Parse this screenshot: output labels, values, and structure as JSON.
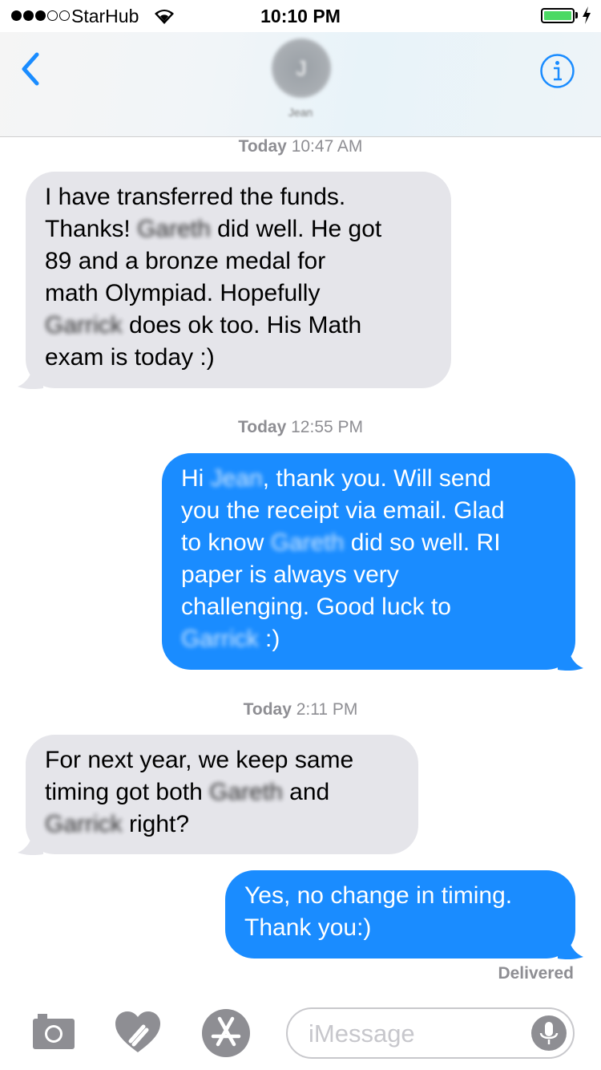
{
  "status_bar": {
    "carrier": "StarHub",
    "time": "10:10 PM",
    "signal_dots_filled": 3,
    "signal_dots_total": 5,
    "battery_level": 1.0,
    "battery_color": "#4cd964"
  },
  "header": {
    "avatar_initial": "J",
    "contact_name": "Jean",
    "back_icon": "chevron-left-icon",
    "info_icon": "info-icon",
    "accent": "#1a8cff"
  },
  "messages": [
    {
      "timestamp_day": "Today",
      "timestamp_time": "10:47 AM",
      "direction": "incoming",
      "lines": [
        "I have transferred the funds.",
        "Thanks! [Gareth] did well. He got",
        "89 and a bronze medal for",
        "math Olympiad. Hopefully",
        "[Garrick] does ok too. His Math",
        "exam is today :)"
      ],
      "line_parts": [
        [
          "I have transferred the funds."
        ],
        [
          "Thanks! ",
          "Gareth",
          " did well. He got"
        ],
        [
          "89 and a bronze medal for"
        ],
        [
          "math Olympiad. Hopefully"
        ],
        [
          "Garrick",
          " does ok too. His Math"
        ],
        [
          "exam is today :)"
        ]
      ]
    },
    {
      "timestamp_day": "Today",
      "timestamp_time": "12:55 PM",
      "direction": "outgoing",
      "line_parts": [
        [
          "Hi ",
          "Jean",
          ", thank you. Will send"
        ],
        [
          "you the receipt via email. Glad"
        ],
        [
          "to know ",
          "Gareth",
          " did so well. RI"
        ],
        [
          "paper is always very"
        ],
        [
          "challenging. Good luck to"
        ],
        [
          "Garrick",
          " :)"
        ]
      ]
    },
    {
      "timestamp_day": "Today",
      "timestamp_time": "2:11 PM",
      "direction": "incoming",
      "line_parts": [
        [
          "For next year, we keep same"
        ],
        [
          "timing got both ",
          "Gareth",
          " and"
        ],
        [
          "Garrick",
          " right?"
        ]
      ]
    },
    {
      "direction": "outgoing",
      "line_parts": [
        [
          "Yes, no change in timing."
        ],
        [
          "Thank you:)"
        ]
      ]
    }
  ],
  "delivery_status": "Delivered",
  "input_bar": {
    "placeholder": "iMessage",
    "camera_icon": "camera-icon",
    "digital_touch_icon": "digital-touch-heart-icon",
    "app_store_icon": "app-store-icon",
    "mic_icon": "microphone-icon"
  },
  "colors": {
    "incoming_bubble": "#e5e5ea",
    "outgoing_bubble": "#1a8cff",
    "timestamp_text": "#8e8e93"
  }
}
